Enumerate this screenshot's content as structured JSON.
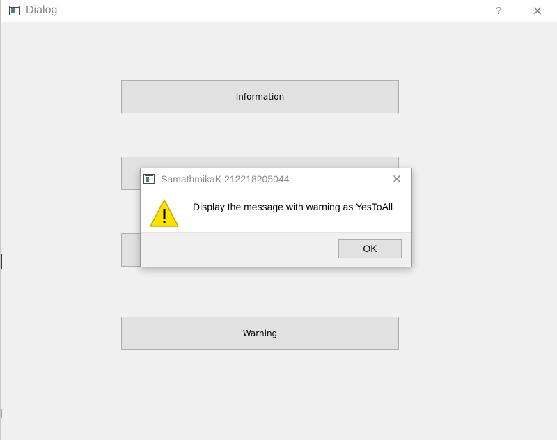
{
  "window": {
    "title": "Dialog",
    "help_label": "?",
    "close_label": "✕"
  },
  "buttons": [
    {
      "label": "Information"
    },
    {
      "label": ""
    },
    {
      "label": ""
    },
    {
      "label": "Warning"
    }
  ],
  "message_box": {
    "title": "SamathmikaK 212218205044",
    "close_label": "✕",
    "icon": "warning-icon",
    "text": "Display the message with warning as YesToAll",
    "ok_label": "OK"
  },
  "colors": {
    "warning_fill": "#FFE100",
    "warning_stroke": "#C8A800"
  }
}
